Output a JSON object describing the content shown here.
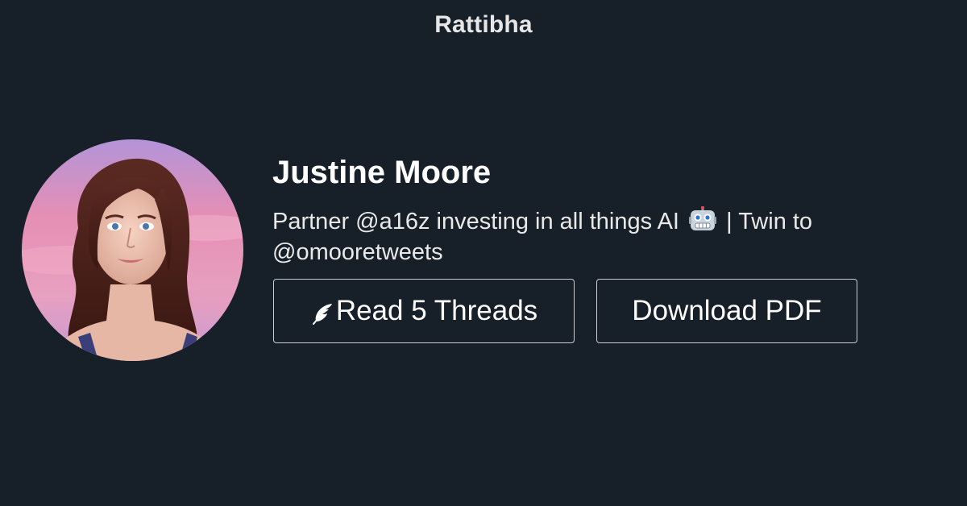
{
  "header": {
    "brand": "Rattibha"
  },
  "profile": {
    "name": "Justine Moore",
    "bio_before_emoji": "Partner @a16z investing in all things AI",
    "bio_emoji_icon": "robot-face-icon",
    "bio_after_emoji": "| Twin to @omooretweets",
    "avatar_icon": "profile-avatar"
  },
  "actions": {
    "read_label": "Read 5 Threads",
    "read_icon": "feather-icon",
    "download_label": "Download PDF"
  },
  "colors": {
    "background": "#171f29",
    "text": "#ffffff",
    "button_border": "#c9ccd1"
  }
}
